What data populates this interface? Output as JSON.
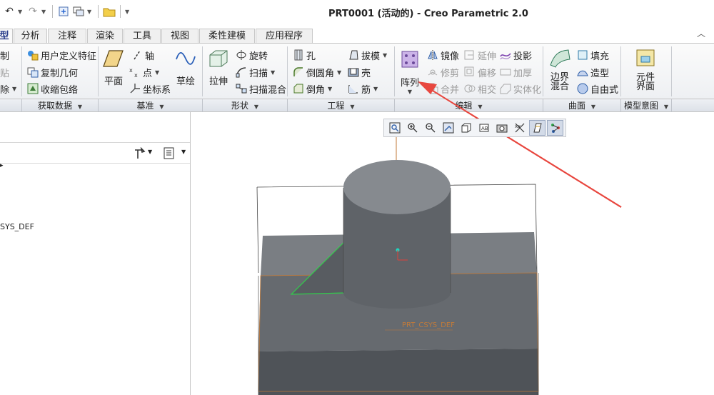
{
  "window": {
    "title": "PRT0001 (活动的) - Creo Parametric 2.0"
  },
  "tabs": [
    {
      "label": "型",
      "active": true
    },
    {
      "label": "分析"
    },
    {
      "label": "注释"
    },
    {
      "label": "渲染"
    },
    {
      "label": "工具"
    },
    {
      "label": "视图"
    },
    {
      "label": "柔性建模"
    },
    {
      "label": "应用程序"
    }
  ],
  "ribbon": {
    "operations": {
      "items": [
        "制",
        "贴",
        "除"
      ]
    },
    "get_data": {
      "items": [
        "用户定义特征",
        "复制几何",
        "收缩包络"
      ]
    },
    "datum": {
      "plane": "平面",
      "axis": "轴",
      "point": "点",
      "csys": "坐标系",
      "sketch": "草绘"
    },
    "shapes": {
      "extrude": "拉伸",
      "revolve": "旋转",
      "sweep": "扫描",
      "swept_blend": "扫描混合"
    },
    "engineering": {
      "hole": "孔",
      "round": "倒圆角",
      "chamfer": "倒角",
      "draft": "拔模",
      "shell": "壳",
      "rib": "筋"
    },
    "editing": {
      "pattern": "阵列",
      "mirror": "镜像",
      "trim": "修剪",
      "merge": "合并",
      "extend": "延伸",
      "offset": "偏移",
      "intersect": "相交",
      "project": "投影",
      "thicken": "加厚",
      "solidify": "实体化"
    },
    "surfaces": {
      "boundary_blend_line1": "边界",
      "boundary_blend_line2": "混合",
      "fill": "填充",
      "style": "造型",
      "freestyle": "自由式"
    },
    "model_intent": {
      "component_interface_line1": "元件",
      "component_interface_line2": "界面"
    }
  },
  "groups": {
    "get_data": "获取数据",
    "datum": "基准",
    "shapes": "形状",
    "engineering": "工程",
    "editing": "编辑",
    "surfaces": "曲面",
    "model_intent": "模型意图"
  },
  "model_tree": {
    "items": [
      "SYS_DEF"
    ]
  },
  "graphics": {
    "csys_label": "PRT_CSYS_DEF"
  },
  "colors": {
    "accent": "#2b3f8c",
    "arrow": "#e8473f",
    "model": "#6d7176",
    "edge": "#c07a3a",
    "highlight": "#2fd04a"
  }
}
